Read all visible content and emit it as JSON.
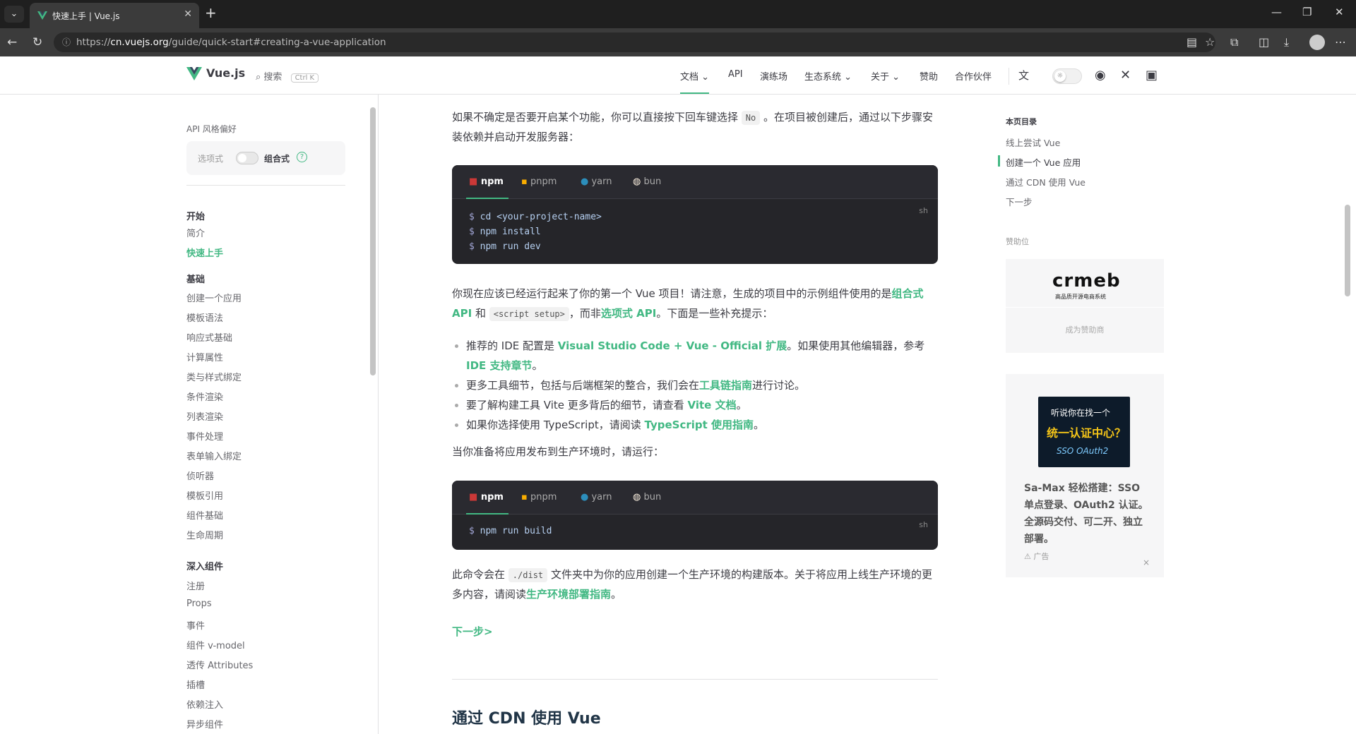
{
  "browser": {
    "tab_title": "快速上手 | Vue.js",
    "tab_close": "✕",
    "new_tab": "+",
    "url_prefix": "https://",
    "url_host": "cn.vuejs.org",
    "url_path": "/guide/quick-start#creating-a-vue-application",
    "controls": {
      "minimize": "—",
      "restore": "❐",
      "close": "✕"
    }
  },
  "header": {
    "logo": "Vue.js",
    "search_label": "搜索",
    "search_kbd": "Ctrl K",
    "nav": [
      {
        "label": "文档 ⌄"
      },
      {
        "label": "API"
      },
      {
        "label": "演练场"
      },
      {
        "label": "生态系统 ⌄"
      },
      {
        "label": "关于 ⌄"
      },
      {
        "label": "赞助"
      },
      {
        "label": "合作伙伴"
      }
    ]
  },
  "sidebar": {
    "pref_title": "API 风格偏好",
    "pref_options": "选项式",
    "pref_composition": "组合式",
    "help": "?",
    "sections": [
      {
        "title": "开始",
        "items": [
          "简介",
          "快速上手"
        ]
      },
      {
        "title": "基础",
        "items": [
          "创建一个应用",
          "模板语法",
          "响应式基础",
          "计算属性",
          "类与样式绑定",
          "条件渲染",
          "列表渲染",
          "事件处理",
          "表单输入绑定",
          "侦听器",
          "模板引用",
          "组件基础",
          "生命周期"
        ]
      },
      {
        "title": "深入组件",
        "items": [
          "注册",
          "Props",
          "事件",
          "组件 v-model",
          "透传 Attributes",
          "插槽",
          "依赖注入",
          "异步组件"
        ]
      }
    ],
    "active_item": "快速上手"
  },
  "content": {
    "p1_a": "如果不确定是否要开启某个功能，你可以直接按下回车键选择",
    "p1_code": "No",
    "p1_b": "。在项目被创建后，通过以下步骤安装依赖并启动开发服务器：",
    "pkg_tabs": [
      "npm",
      "pnpm",
      "yarn",
      "bun"
    ],
    "lang": "sh",
    "code1": [
      "cd <your-project-name>",
      "npm install",
      "npm run dev"
    ],
    "p2_a": "你现在应该已经运行起来了你的第一个 Vue 项目！请注意，生成的项目中的示例组件使用的是",
    "p2_link1": "组合式 API",
    "p2_and": " 和 ",
    "p2_code": "<script setup>",
    "p2_b": "，而非",
    "p2_link2": "选项式 API",
    "p2_c": "。下面是一些补充提示：",
    "bullets": [
      {
        "pre": "推荐的 IDE 配置是 ",
        "link": "Visual Studio Code + Vue - Official 扩展",
        "post": "。如果使用其他编辑器，参考",
        "link2": "IDE 支持章节",
        "post2": "。"
      },
      {
        "pre": "更多工具细节，包括与后端框架的整合，我们会在",
        "link": "工具链指南",
        "post": "进行讨论。"
      },
      {
        "pre": "要了解构建工具 Vite 更多背后的细节，请查看 ",
        "link": "Vite 文档",
        "post": "。"
      },
      {
        "pre": "如果你选择使用 TypeScript，请阅读 ",
        "link": "TypeScript 使用指南",
        "post": "。"
      }
    ],
    "p3": "当你准备将应用发布到生产环境时，请运行：",
    "code2": [
      "npm run build"
    ],
    "p4_a": "此命令会在",
    "p4_code": "./dist",
    "p4_b": "文件夹中为你的应用创建一个生产环境的构建版本。关于将应用上线生产环境的更多内容，请阅读",
    "p4_link": "生产环境部署指南",
    "p4_c": "。",
    "next": "下一步>",
    "h2": "通过 CDN 使用 Vue"
  },
  "toc": {
    "title": "本页目录",
    "items": [
      "线上尝试 Vue",
      "创建一个 Vue 应用",
      "通过 CDN 使用 Vue",
      "下一步"
    ],
    "active": "创建一个 Vue 应用"
  },
  "sponsors": {
    "label": "赞助位",
    "brand": "crmeb",
    "brand_tag": "高品质开源电商系统",
    "become": "成为赞助商"
  },
  "ad": {
    "img_line1": "听说你在找一个",
    "img_line2": "统一认证中心？",
    "img_line3": "SSO OAuth2",
    "desc": "Sa-Max 轻松搭建：SSO 单点登录、OAuth2 认证。全源码交付、可二开、独立部署。",
    "label": "广告",
    "close": "×"
  },
  "colors": {
    "brand": "#42b883",
    "text": "#3c3c43",
    "code_bg": "#252529"
  }
}
